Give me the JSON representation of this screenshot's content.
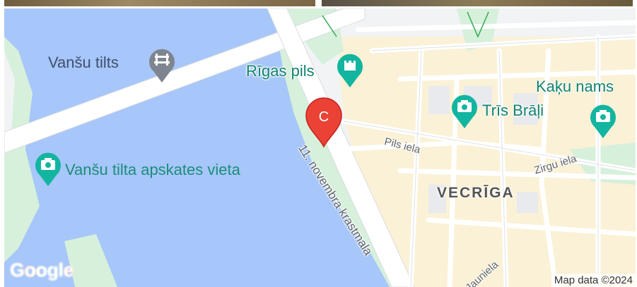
{
  "map": {
    "places": {
      "vansu_tilts": "Vanšu tilts",
      "rigas_pils": "Rīgas pils",
      "kaku_nams": "Kaķu nams",
      "tris_brali": "Trīs Brāļi",
      "vansu_tilta_view": "Vanšu tilta apskates vieta",
      "vecriga": "VECRĪGA"
    },
    "streets": {
      "pils_iela": "Pils iela",
      "zirgu_iela": "Zirgu iela",
      "krastmala": "11. novembra krastmala",
      "jauniela": "Jauniela"
    },
    "marker": {
      "letter": "C",
      "color": "#ea4335"
    },
    "attribution": "Map data ©2024",
    "logo": "Google",
    "colors": {
      "water": "#a7c6f9",
      "land": "#f1f3f4",
      "oldtown": "#fbf1d6",
      "park": "#d6f0dc",
      "poi_teal": "#12b5a0"
    }
  }
}
